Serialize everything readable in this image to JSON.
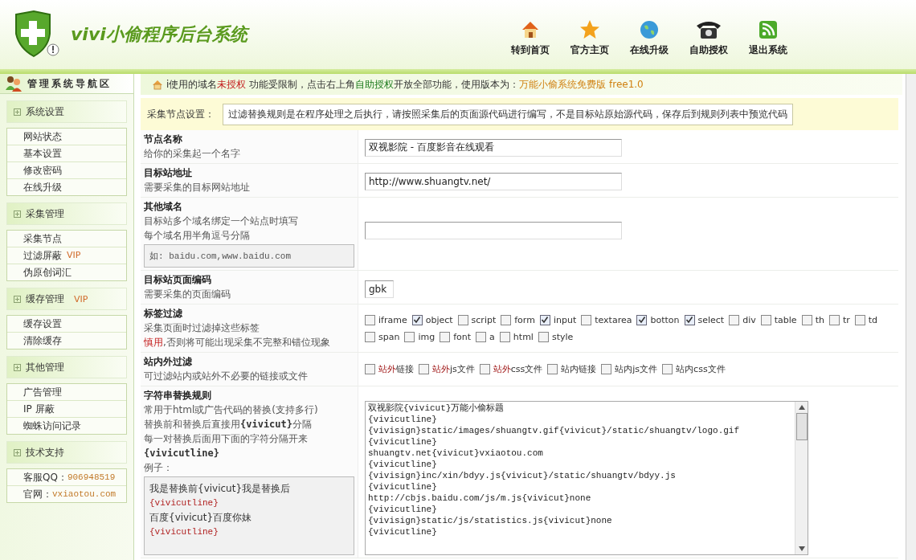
{
  "brand": {
    "title": "vivi小偷程序后台系统"
  },
  "nav": [
    {
      "label": "转到首页",
      "kind": "home"
    },
    {
      "label": "官方主页",
      "kind": "star"
    },
    {
      "label": "在线升级",
      "kind": "globe"
    },
    {
      "label": "自助授权",
      "kind": "phone"
    },
    {
      "label": "退出系统",
      "kind": "rss"
    }
  ],
  "sidebar": {
    "title": "管理系统导航区",
    "groups": [
      {
        "title": "系统设置",
        "items": [
          {
            "label": "网站状态"
          },
          {
            "label": "基本设置"
          },
          {
            "label": "修改密码"
          },
          {
            "label": "在线升级"
          }
        ]
      },
      {
        "title": "采集管理",
        "items": [
          {
            "label": "采集节点"
          },
          {
            "label": "过滤屏蔽",
            "badge": "VIP"
          },
          {
            "label": "伪原创词汇"
          }
        ]
      },
      {
        "title": "缓存管理",
        "badge": "VIP",
        "items": [
          {
            "label": "缓存设置"
          },
          {
            "label": "清除缓存"
          }
        ]
      },
      {
        "title": "其他管理",
        "items": [
          {
            "label": "广告管理"
          },
          {
            "label": "IP 屏蔽"
          },
          {
            "label": "蜘蛛访问记录"
          }
        ]
      },
      {
        "title": "技术支持",
        "items": [
          {
            "label": "客服QQ：",
            "value": "906948519"
          },
          {
            "label": "官网：",
            "value": "vxiaotou.com"
          }
        ]
      }
    ]
  },
  "notice": [
    {
      "text": "i使用的域名",
      "kind": "plain"
    },
    {
      "text": "未授权",
      "kind": "alert"
    },
    {
      "text": " 功能受限制，点击右上角",
      "kind": "plain"
    },
    {
      "text": "自助授权",
      "kind": "link"
    },
    {
      "text": "开放全部功能，使用版本为：",
      "kind": "plain"
    },
    {
      "text": "万能小偷系统免费版 free1.0",
      "kind": "version"
    }
  ],
  "section": {
    "title": "采集节点设置：",
    "hint": "过滤替换规则是在程序处理之后执行，请按照采集后的页面源代码进行编写，不是目标站原始源代码，保存后到规则列表中预览代码"
  },
  "rows": [
    {
      "kind": "text",
      "title": "节点名称",
      "desc": [
        "给你的采集起一个名字"
      ],
      "value": "双视影院 - 百度影音在线观看"
    },
    {
      "kind": "text",
      "title": "目标站地址",
      "desc": [
        "需要采集的目标网站地址"
      ],
      "value": "http://www.shuangtv.net/"
    },
    {
      "kind": "domains",
      "title": "其他域名",
      "desc": [
        "目标站多个域名绑定一个站点时填写",
        "每个域名用半角逗号分隔"
      ],
      "example": "如: baidu.com,www.baidu.com",
      "value": ""
    },
    {
      "kind": "short",
      "title": "目标站页面编码",
      "desc": [
        "需要采集的页面编码"
      ],
      "value": "gbk"
    },
    {
      "kind": "tags",
      "title": "标签过滤",
      "desc": [
        "采集页面时过滤掉这些标签",
        "**慎用**,否则将可能出现采集不完整和错位现象"
      ],
      "options": [
        {
          "label": "iframe",
          "checked": false
        },
        {
          "label": "object",
          "checked": true
        },
        {
          "label": "script",
          "checked": false
        },
        {
          "label": "form",
          "checked": false
        },
        {
          "label": "input",
          "checked": true
        },
        {
          "label": "textarea",
          "checked": false
        },
        {
          "label": "botton",
          "checked": true
        },
        {
          "label": "select",
          "checked": true
        },
        {
          "label": "div",
          "checked": false
        },
        {
          "label": "table",
          "checked": false
        },
        {
          "label": "th",
          "checked": false
        },
        {
          "label": "tr",
          "checked": false
        },
        {
          "label": "td",
          "checked": false
        },
        {
          "label": "span",
          "checked": false
        },
        {
          "label": "img",
          "checked": false
        },
        {
          "label": "font",
          "checked": false
        },
        {
          "label": "a",
          "checked": false
        },
        {
          "label": "html",
          "checked": false
        },
        {
          "label": "style",
          "checked": false
        }
      ]
    },
    {
      "kind": "site",
      "title": "站内外过滤",
      "desc": [
        "可过滤站内或站外不必要的链接或文件"
      ],
      "options": [
        {
          "highlight": "站外",
          "label": "链接",
          "checked": false
        },
        {
          "highlight": "站外",
          "label": "js文件",
          "checked": false
        },
        {
          "highlight": "站外",
          "label": "css文件",
          "checked": false
        },
        {
          "label": "站内链接",
          "checked": false
        },
        {
          "label": "站内js文件",
          "checked": false
        },
        {
          "label": "站内css文件",
          "checked": false
        }
      ]
    },
    {
      "kind": "rules",
      "title": "字符串替换规则",
      "desc": [
        "常用于html或广告代码的替换(支持多行)",
        "替换前和替换后直接用**{vivicut}**分隔",
        "每一对替换后面用下面的字符分隔开来",
        "**{vivicutline}**",
        "例子："
      ],
      "example_lines": [
        {
          "text": "我是替换前{vivicut}我是替换后",
          "kind": "plain"
        },
        {
          "text": "{vivicutline}",
          "kind": "sep"
        },
        {
          "text": "百度{vivicut}百度你妹",
          "kind": "plain"
        },
        {
          "text": "{vivicutline}",
          "kind": "sep"
        }
      ],
      "value": "双视影院{vivicut}万能小偷标题\n{vivicutline}\n{vivisign}static/images/shuangtv.gif{vivicut}/static/shuangtv/logo.gif\n{vivicutline}\nshuangtv.net{vivicut}vxiaotou.com\n{vivicutline}\n{vivisign}inc/xin/bdyy.js{vivicut}/static/shuangtv/bdyy.js\n{vivicutline}\nhttp://cbjs.baidu.com/js/m.js{vivicut}none\n{vivicutline}\n{vivisign}static/js/statistics.js{vivicut}none\n{vivicutline}"
    }
  ]
}
